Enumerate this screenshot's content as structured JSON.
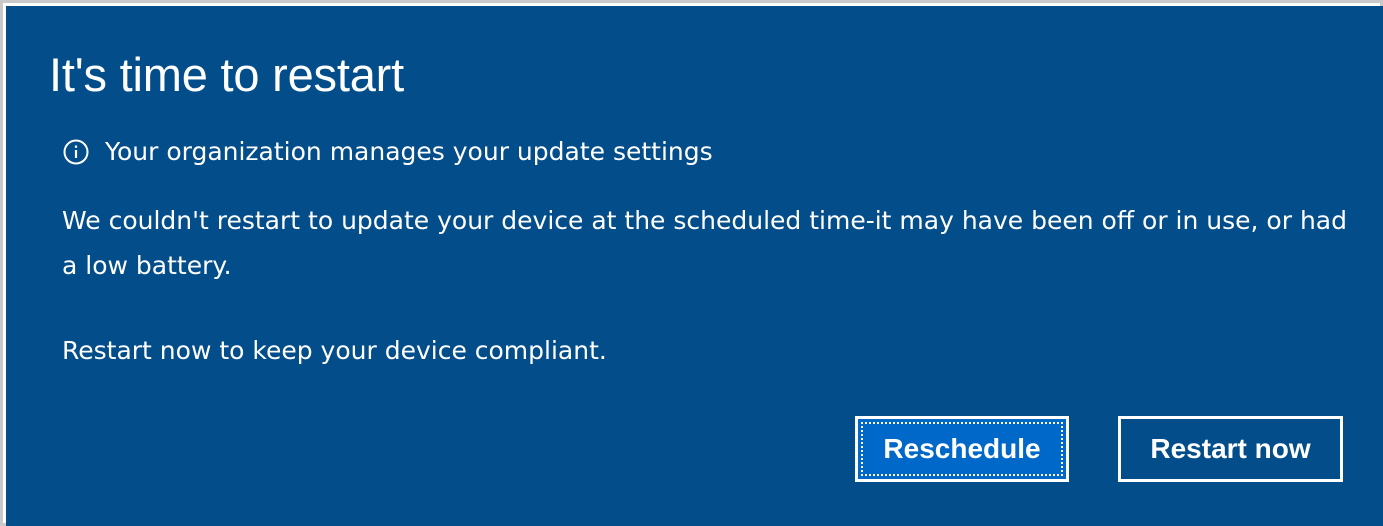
{
  "dialog": {
    "title": "It's time to restart",
    "org_notice": "Your organization manages your update settings",
    "org_notice_icon": "info-icon",
    "body": "We couldn't restart to update your device at the scheduled time-it may have been off or in use, or had a low battery.",
    "compliance": "Restart now to keep your device compliant.",
    "background_color": "#024d8a"
  },
  "buttons": {
    "reschedule_label": "Reschedule",
    "restart_now_label": "Restart now",
    "focused_color": "#0068c8"
  }
}
